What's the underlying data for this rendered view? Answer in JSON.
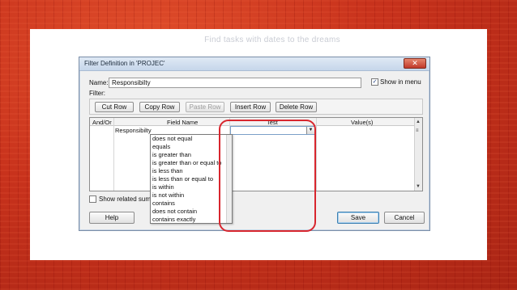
{
  "background_color": "#c8321c",
  "faded_title": "Find tasks with dates to the dreams",
  "dialog": {
    "title": "Filter Definition in 'PROJEC'",
    "close_glyph": "✕",
    "name_label": "Name:",
    "name_value": "Responsibilty",
    "show_in_menu_label": "Show in menu",
    "show_in_menu_checked": true,
    "filter_label": "Filter:",
    "toolbar": {
      "cut_row": "Cut Row",
      "copy_row": "Copy Row",
      "paste_row": "Paste Row",
      "insert_row": "Insert Row",
      "delete_row": "Delete Row"
    },
    "grid": {
      "headers": [
        "And/Or",
        "Field Name",
        "Test",
        "Value(s)"
      ],
      "rows": [
        {
          "and_or": "",
          "field_name": "Responsibilty",
          "test": "",
          "values": ""
        }
      ]
    },
    "test_options": [
      "does not equal",
      "equals",
      "is greater than",
      "is greater than or equal to",
      "is less than",
      "is less than or equal to",
      "is within",
      "is not within",
      "contains",
      "does not contain",
      "contains exactly"
    ],
    "show_summary_label": "Show related summary rows",
    "help_label": "Help",
    "save_label": "Save",
    "cancel_label": "Cancel",
    "highlight_color": "#d8262e"
  }
}
